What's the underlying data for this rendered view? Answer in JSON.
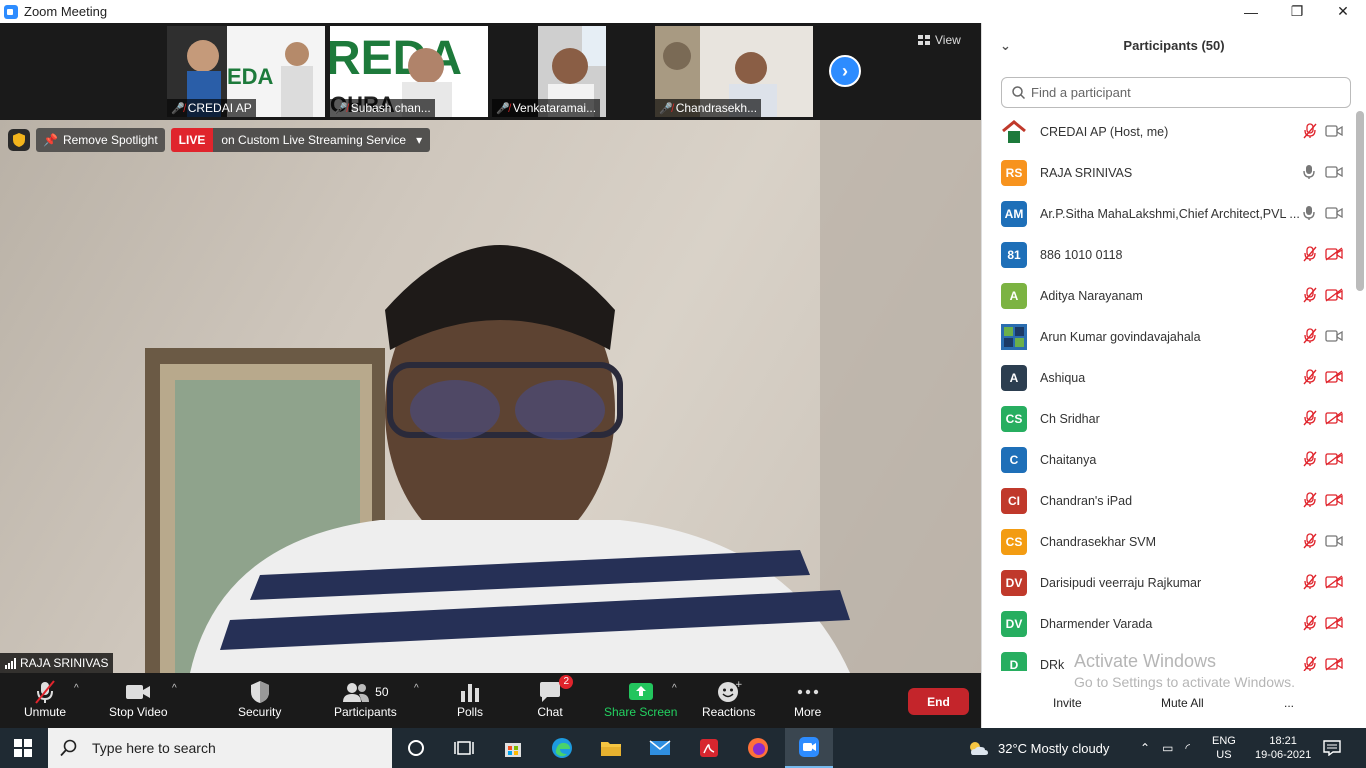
{
  "window": {
    "title": "Zoom Meeting",
    "minimize": "—",
    "restore": "❐",
    "close": "✕"
  },
  "thumbnails": [
    {
      "name": "CREDAI AP"
    },
    {
      "name": "Subash chan..."
    },
    {
      "name": "Venkataramai..."
    },
    {
      "name": "Chandrasekh..."
    }
  ],
  "view_label": "View",
  "spotlight": {
    "remove_label": "Remove Spotlight",
    "live_label": "LIVE",
    "stream_label": "on Custom Live Streaming Service"
  },
  "speaker_name": "RAJA SRINIVAS",
  "toolbar": {
    "unmute": "Unmute",
    "stop_video": "Stop Video",
    "security": "Security",
    "participants": "Participants",
    "participants_count": "50",
    "polls": "Polls",
    "chat": "Chat",
    "chat_badge": "2",
    "share_screen": "Share Screen",
    "reactions": "Reactions",
    "more": "More",
    "end": "End"
  },
  "panel": {
    "title": "Participants (50)",
    "search_placeholder": "Find a participant",
    "participants": [
      {
        "initials": "",
        "name": "CREDAI AP (Host, me)",
        "color": "#ffffff",
        "logo": "credai"
      },
      {
        "initials": "RS",
        "name": "RAJA SRINIVAS",
        "color": "#F7931E"
      },
      {
        "initials": "AM",
        "name": "Ar.P.Sitha MahaLakshmi,Chief Architect,PVL ...",
        "color": "#1E6FB8"
      },
      {
        "initials": "81",
        "name": "886 1010 0118",
        "color": "#1E6FB8"
      },
      {
        "initials": "A",
        "name": "Aditya Narayanam",
        "color": "#7CB342"
      },
      {
        "initials": "",
        "name": "Arun Kumar govindavajahala",
        "color": "#ffffff",
        "logo": "pattern"
      },
      {
        "initials": "A",
        "name": "Ashiqua",
        "color": "#2C3E50"
      },
      {
        "initials": "CS",
        "name": "Ch Sridhar",
        "color": "#27AE60"
      },
      {
        "initials": "C",
        "name": "Chaitanya",
        "color": "#1E6FB8"
      },
      {
        "initials": "CI",
        "name": "Chandran's iPad",
        "color": "#C0392B"
      },
      {
        "initials": "CS",
        "name": "Chandrasekhar SVM",
        "color": "#F39C12"
      },
      {
        "initials": "DV",
        "name": "Darisipudi veerraju Rajkumar",
        "color": "#C0392B"
      },
      {
        "initials": "DV",
        "name": "Dharmender Varada",
        "color": "#27AE60"
      },
      {
        "initials": "D",
        "name": "DRk",
        "color": "#27AE60"
      }
    ],
    "invite": "Invite",
    "mute_all": "Mute All",
    "more": "...",
    "watermark_line1": "Activate Windows",
    "watermark_line2": "Go to Settings to activate Windows."
  },
  "taskbar": {
    "search_placeholder": "Type here to search",
    "weather": "32°C  Mostly cloudy",
    "lang1": "ENG",
    "lang2": "US",
    "time": "18:21",
    "date": "19-06-2021"
  }
}
